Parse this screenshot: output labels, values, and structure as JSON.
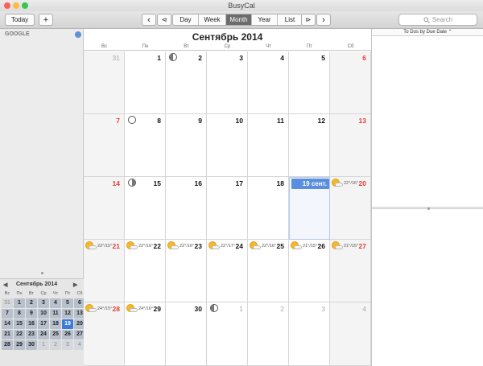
{
  "window": {
    "title": "BusyCal"
  },
  "toolbar": {
    "today_label": "Today",
    "add_label": "+",
    "prev_label": "‹",
    "back_label": "⊲",
    "views": [
      {
        "label": "Day",
        "selected": false
      },
      {
        "label": "Week",
        "selected": false
      },
      {
        "label": "Month",
        "selected": true
      },
      {
        "label": "Year",
        "selected": false
      },
      {
        "label": "List",
        "selected": false
      }
    ],
    "fwd_label": "⊳",
    "next_label": "›",
    "search_placeholder": "Search"
  },
  "sidebar": {
    "account_label": "GOOGLE"
  },
  "mini_calendar": {
    "title": "Сентябрь 2014",
    "prev": "◀",
    "next": "▶",
    "weekdays": [
      "Вс",
      "Пн",
      "Вт",
      "Ср",
      "Чт",
      "Пт",
      "Сб"
    ],
    "weeks": [
      [
        "31",
        "1",
        "2",
        "3",
        "4",
        "5",
        "6"
      ],
      [
        "7",
        "8",
        "9",
        "10",
        "11",
        "12",
        "13"
      ],
      [
        "14",
        "15",
        "16",
        "17",
        "18",
        "19",
        "20"
      ],
      [
        "21",
        "22",
        "23",
        "24",
        "25",
        "26",
        "27"
      ],
      [
        "28",
        "29",
        "30",
        "1",
        "2",
        "3",
        "4"
      ]
    ]
  },
  "calendar": {
    "title": "Сентябрь 2014",
    "weekdays": [
      "Вс",
      "Пн",
      "Вт",
      "Ср",
      "Чт",
      "Пт",
      "Сб"
    ],
    "today_badge": "19 сент.",
    "days": [
      {
        "n": "31",
        "dim": true
      },
      {
        "n": "1"
      },
      {
        "n": "2",
        "moon": "first"
      },
      {
        "n": "3"
      },
      {
        "n": "4"
      },
      {
        "n": "5"
      },
      {
        "n": "6"
      },
      {
        "n": "7"
      },
      {
        "n": "8",
        "moon": "full"
      },
      {
        "n": "9"
      },
      {
        "n": "10"
      },
      {
        "n": "11"
      },
      {
        "n": "12"
      },
      {
        "n": "13"
      },
      {
        "n": "14"
      },
      {
        "n": "15",
        "moon": "last"
      },
      {
        "n": "16"
      },
      {
        "n": "17"
      },
      {
        "n": "18"
      },
      {
        "n": "19",
        "today": true
      },
      {
        "n": "20",
        "temp": "22°/16°"
      },
      {
        "n": "21",
        "temp": "22°/15°"
      },
      {
        "n": "22",
        "temp": "22°/16°"
      },
      {
        "n": "23",
        "temp": "22°/16°"
      },
      {
        "n": "24",
        "temp": "22°/17°"
      },
      {
        "n": "25",
        "temp": "22°/16°"
      },
      {
        "n": "26",
        "temp": "21°/15°"
      },
      {
        "n": "27",
        "temp": "21°/15°"
      },
      {
        "n": "28",
        "temp": "24°/15°"
      },
      {
        "n": "29",
        "temp": "24°/16°"
      },
      {
        "n": "30"
      },
      {
        "n": "1",
        "dim": true,
        "moon": "first"
      },
      {
        "n": "2",
        "dim": true
      },
      {
        "n": "3",
        "dim": true
      },
      {
        "n": "4",
        "dim": true
      }
    ]
  },
  "todo": {
    "header": "To Dos by Due Date ⌃"
  },
  "colors": {
    "accent": "#3d7bd6",
    "weekend": "#e0403c"
  }
}
